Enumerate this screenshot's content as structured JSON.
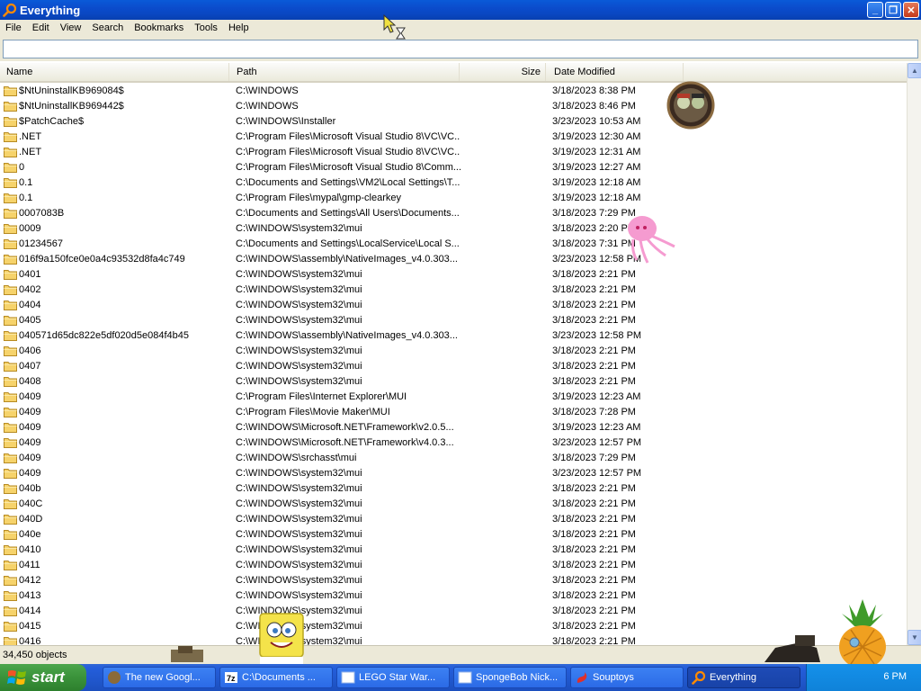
{
  "window": {
    "title": "Everything"
  },
  "menu": [
    "File",
    "Edit",
    "View",
    "Search",
    "Bookmarks",
    "Tools",
    "Help"
  ],
  "search": {
    "value": "",
    "placeholder": ""
  },
  "columns": {
    "name": "Name",
    "path": "Path",
    "size": "Size",
    "date": "Date Modified"
  },
  "rows": [
    {
      "name": "$NtUninstallKB969084$",
      "path": "C:\\WINDOWS",
      "date": "3/18/2023 8:38 PM"
    },
    {
      "name": "$NtUninstallKB969442$",
      "path": "C:\\WINDOWS",
      "date": "3/18/2023 8:46 PM"
    },
    {
      "name": "$PatchCache$",
      "path": "C:\\WINDOWS\\Installer",
      "date": "3/23/2023 10:53 AM"
    },
    {
      "name": ".NET",
      "path": "C:\\Program Files\\Microsoft Visual Studio 8\\VC\\VC...",
      "date": "3/19/2023 12:30 AM"
    },
    {
      "name": ".NET",
      "path": "C:\\Program Files\\Microsoft Visual Studio 8\\VC\\VC...",
      "date": "3/19/2023 12:31 AM"
    },
    {
      "name": "0",
      "path": "C:\\Program Files\\Microsoft Visual Studio 8\\Comm...",
      "date": "3/19/2023 12:27 AM"
    },
    {
      "name": "0.1",
      "path": "C:\\Documents and Settings\\VM2\\Local Settings\\T...",
      "date": "3/19/2023 12:18 AM"
    },
    {
      "name": "0.1",
      "path": "C:\\Program Files\\mypal\\gmp-clearkey",
      "date": "3/19/2023 12:18 AM"
    },
    {
      "name": "0007083B",
      "path": "C:\\Documents and Settings\\All Users\\Documents...",
      "date": "3/18/2023 7:29 PM"
    },
    {
      "name": "0009",
      "path": "C:\\WINDOWS\\system32\\mui",
      "date": "3/18/2023 2:20 PM"
    },
    {
      "name": "01234567",
      "path": "C:\\Documents and Settings\\LocalService\\Local S...",
      "date": "3/18/2023 7:31 PM"
    },
    {
      "name": "016f9a150fce0e0a4c93532d8fa4c749",
      "path": "C:\\WINDOWS\\assembly\\NativeImages_v4.0.303...",
      "date": "3/23/2023 12:58 PM"
    },
    {
      "name": "0401",
      "path": "C:\\WINDOWS\\system32\\mui",
      "date": "3/18/2023 2:21 PM"
    },
    {
      "name": "0402",
      "path": "C:\\WINDOWS\\system32\\mui",
      "date": "3/18/2023 2:21 PM"
    },
    {
      "name": "0404",
      "path": "C:\\WINDOWS\\system32\\mui",
      "date": "3/18/2023 2:21 PM"
    },
    {
      "name": "0405",
      "path": "C:\\WINDOWS\\system32\\mui",
      "date": "3/18/2023 2:21 PM"
    },
    {
      "name": "040571d65dc822e5df020d5e084f4b45",
      "path": "C:\\WINDOWS\\assembly\\NativeImages_v4.0.303...",
      "date": "3/23/2023 12:58 PM"
    },
    {
      "name": "0406",
      "path": "C:\\WINDOWS\\system32\\mui",
      "date": "3/18/2023 2:21 PM"
    },
    {
      "name": "0407",
      "path": "C:\\WINDOWS\\system32\\mui",
      "date": "3/18/2023 2:21 PM"
    },
    {
      "name": "0408",
      "path": "C:\\WINDOWS\\system32\\mui",
      "date": "3/18/2023 2:21 PM"
    },
    {
      "name": "0409",
      "path": "C:\\Program Files\\Internet Explorer\\MUI",
      "date": "3/19/2023 12:23 AM"
    },
    {
      "name": "0409",
      "path": "C:\\Program Files\\Movie Maker\\MUI",
      "date": "3/18/2023 7:28 PM"
    },
    {
      "name": "0409",
      "path": "C:\\WINDOWS\\Microsoft.NET\\Framework\\v2.0.5...",
      "date": "3/19/2023 12:23 AM"
    },
    {
      "name": "0409",
      "path": "C:\\WINDOWS\\Microsoft.NET\\Framework\\v4.0.3...",
      "date": "3/23/2023 12:57 PM"
    },
    {
      "name": "0409",
      "path": "C:\\WINDOWS\\srchasst\\mui",
      "date": "3/18/2023 7:29 PM"
    },
    {
      "name": "0409",
      "path": "C:\\WINDOWS\\system32\\mui",
      "date": "3/23/2023 12:57 PM"
    },
    {
      "name": "040b",
      "path": "C:\\WINDOWS\\system32\\mui",
      "date": "3/18/2023 2:21 PM"
    },
    {
      "name": "040C",
      "path": "C:\\WINDOWS\\system32\\mui",
      "date": "3/18/2023 2:21 PM"
    },
    {
      "name": "040D",
      "path": "C:\\WINDOWS\\system32\\mui",
      "date": "3/18/2023 2:21 PM"
    },
    {
      "name": "040e",
      "path": "C:\\WINDOWS\\system32\\mui",
      "date": "3/18/2023 2:21 PM"
    },
    {
      "name": "0410",
      "path": "C:\\WINDOWS\\system32\\mui",
      "date": "3/18/2023 2:21 PM"
    },
    {
      "name": "0411",
      "path": "C:\\WINDOWS\\system32\\mui",
      "date": "3/18/2023 2:21 PM"
    },
    {
      "name": "0412",
      "path": "C:\\WINDOWS\\system32\\mui",
      "date": "3/18/2023 2:21 PM"
    },
    {
      "name": "0413",
      "path": "C:\\WINDOWS\\system32\\mui",
      "date": "3/18/2023 2:21 PM"
    },
    {
      "name": "0414",
      "path": "C:\\WINDOWS\\system32\\mui",
      "date": "3/18/2023 2:21 PM"
    },
    {
      "name": "0415",
      "path": "C:\\WINDOWS\\system32\\mui",
      "date": "3/18/2023 2:21 PM"
    },
    {
      "name": "0416",
      "path": "C:\\WINDOWS\\system32\\mui",
      "date": "3/18/2023 2:21 PM"
    }
  ],
  "status": {
    "text": "34,450 objects"
  },
  "taskbar": {
    "start_label": "start",
    "tasks": [
      {
        "label": "The new Googl...",
        "icon": "browser-icon"
      },
      {
        "label": "C:\\Documents ...",
        "icon": "7zip-icon"
      },
      {
        "label": "LEGO Star War...",
        "icon": "window-icon"
      },
      {
        "label": "SpongeBob Nick...",
        "icon": "window-icon"
      },
      {
        "label": "Souptoys",
        "icon": "souptoys-icon"
      },
      {
        "label": "Everything",
        "icon": "everything-icon"
      }
    ],
    "clock": "6 PM"
  },
  "colors": {
    "titlebar": "#0b4ccc",
    "taskbar": "#245edb",
    "start": "#3a923a",
    "folder": "#f6d36b"
  }
}
